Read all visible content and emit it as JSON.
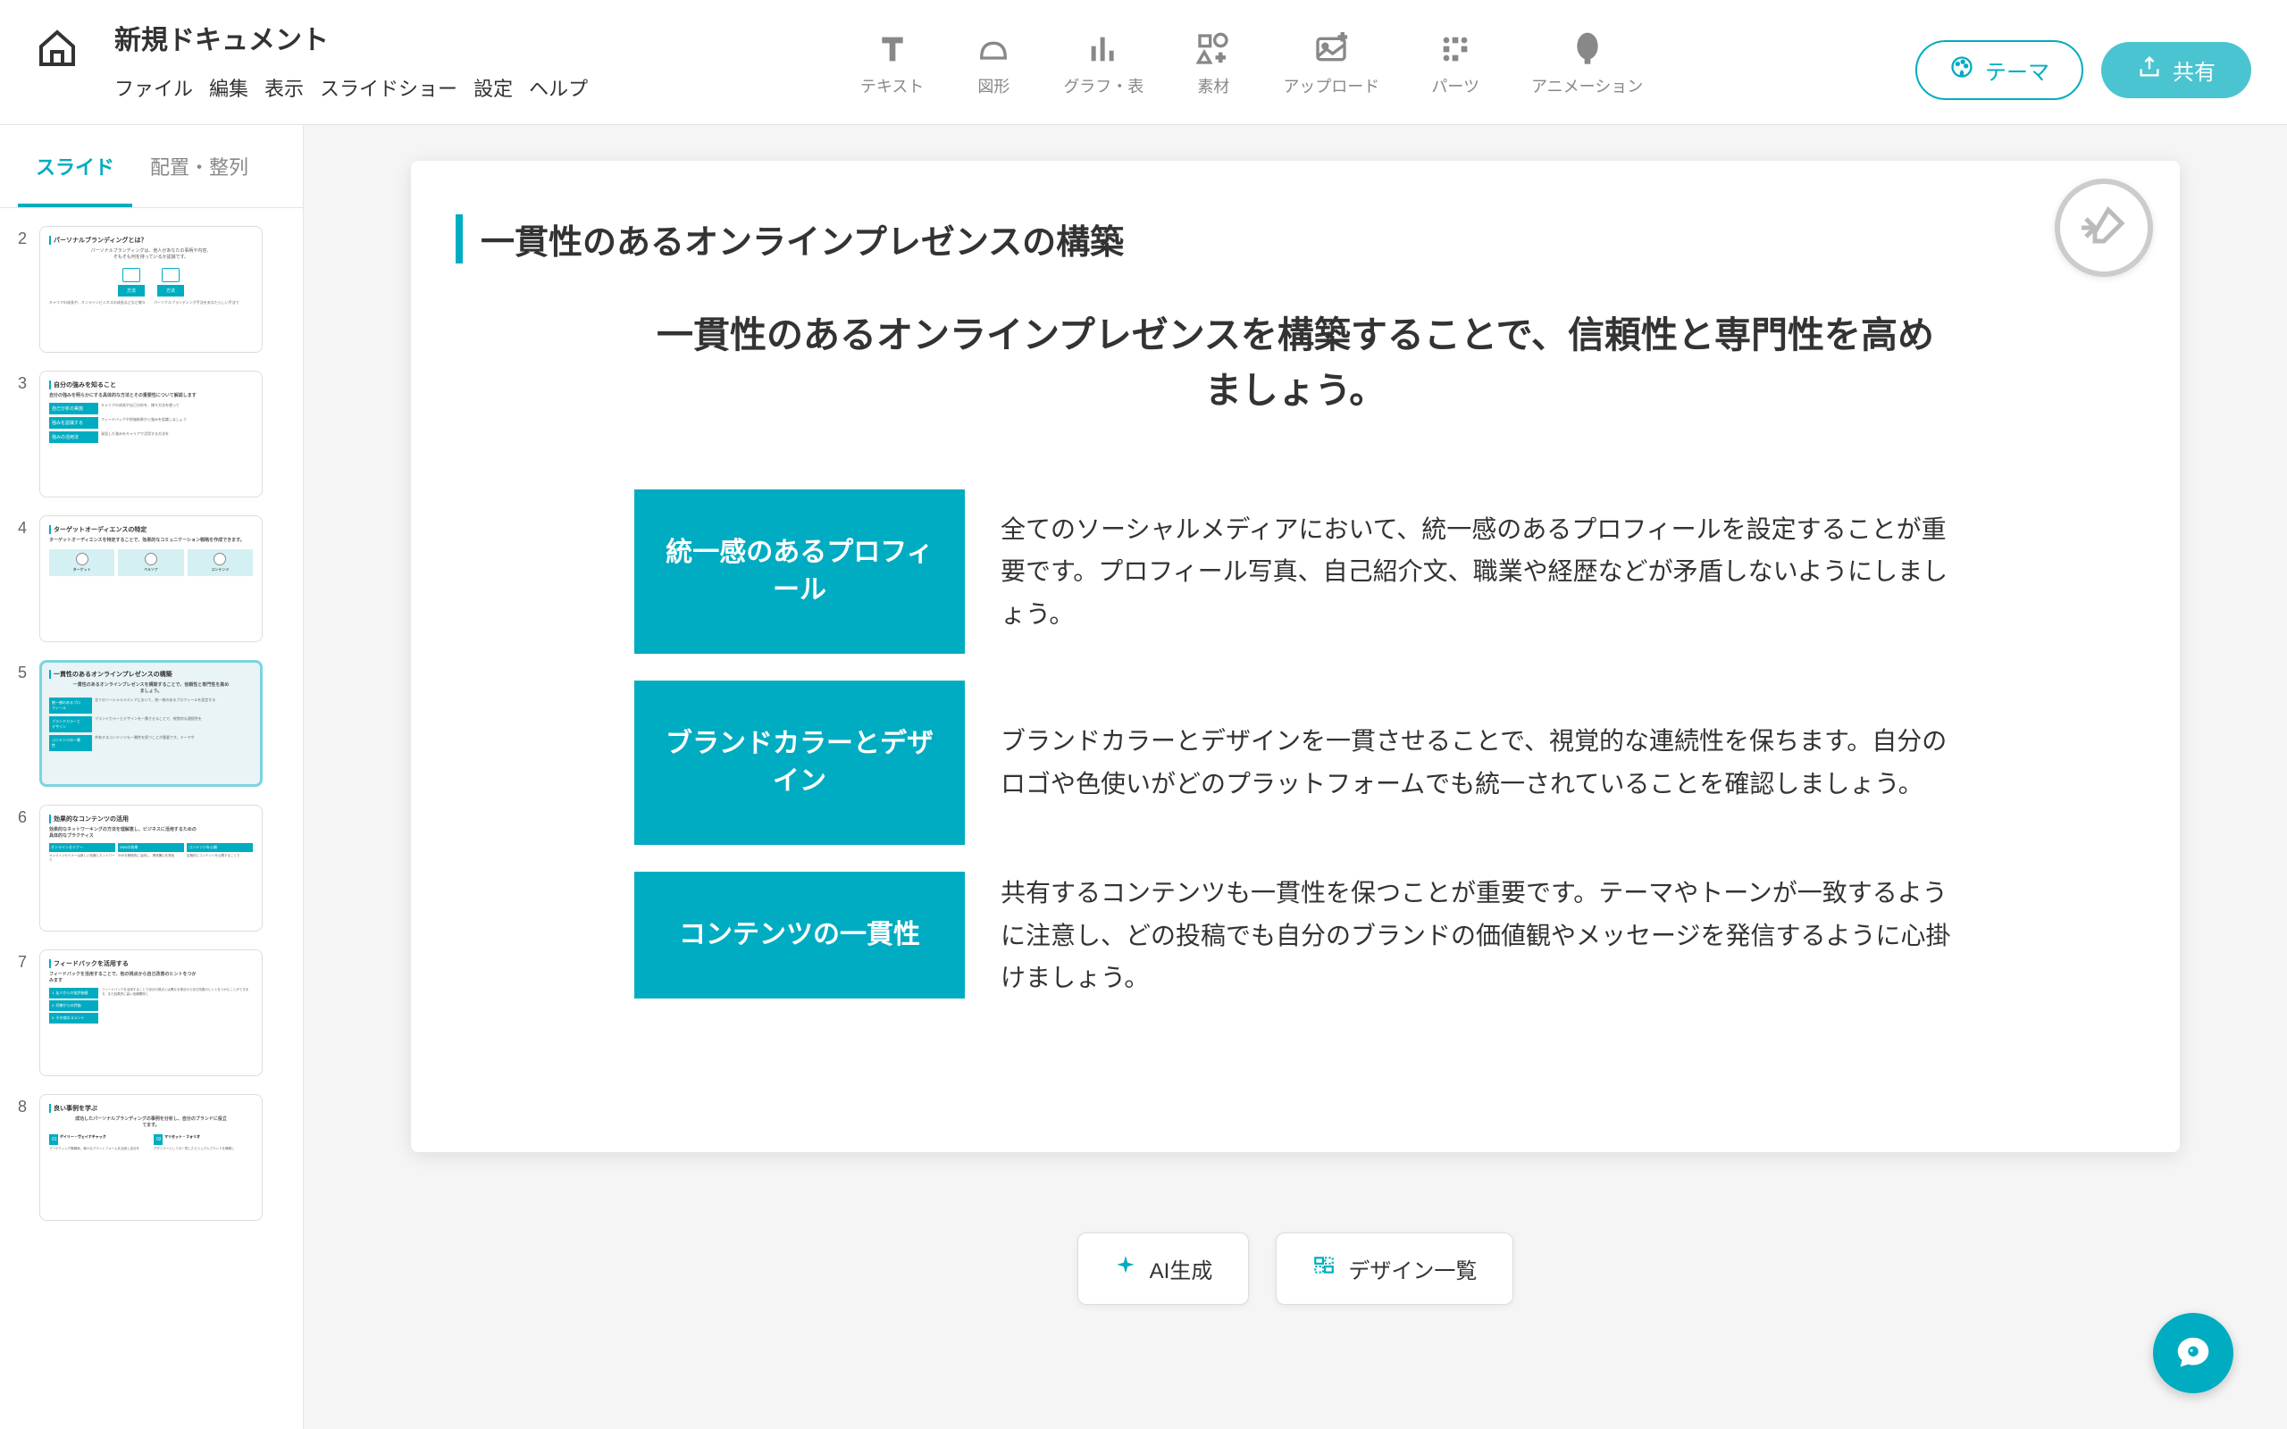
{
  "doc": {
    "title": "新規ドキュメント"
  },
  "menu": {
    "file": "ファイル",
    "edit": "編集",
    "view": "表示",
    "slideshow": "スライドショー",
    "settings": "設定",
    "help": "ヘルプ"
  },
  "toolbar": {
    "text": "テキスト",
    "shape": "図形",
    "chart": "グラフ・表",
    "material": "素材",
    "upload": "アップロード",
    "parts": "パーツ",
    "animation": "アニメーション"
  },
  "header": {
    "theme": "テーマ",
    "share": "共有"
  },
  "sidebar": {
    "tab_slide": "スライド",
    "tab_arrange": "配置・整列"
  },
  "thumbs": {
    "n2": "2",
    "n3": "3",
    "n4": "4",
    "n5": "5",
    "n6": "6",
    "n7": "7",
    "n8": "8"
  },
  "slide": {
    "title": "一貫性のあるオンラインプレゼンスの構築",
    "subtitle": "一貫性のあるオンラインプレゼンスを構築することで、信頼性と専門性を高めましょう。",
    "rows": [
      {
        "label": "統一感のあるプロフィール",
        "text": "全てのソーシャルメディアにおいて、統一感のあるプロフィールを設定することが重要です。プロフィール写真、自己紹介文、職業や経歴などが矛盾しないようにしましょう。"
      },
      {
        "label": "ブランドカラーとデザイン",
        "text": "ブランドカラーとデザインを一貫させることで、視覚的な連続性を保ちます。自分のロゴや色使いがどのプラットフォームでも統一されていることを確認しましょう。"
      },
      {
        "label": "コンテンツの一貫性",
        "text": "共有するコンテンツも一貫性を保つことが重要です。テーマやトーンが一致するように注意し、どの投稿でも自分のブランドの価値観やメッセージを発信するように心掛けましょう。"
      }
    ]
  },
  "actions": {
    "ai": "AI生成",
    "design": "デザイン一覧"
  }
}
